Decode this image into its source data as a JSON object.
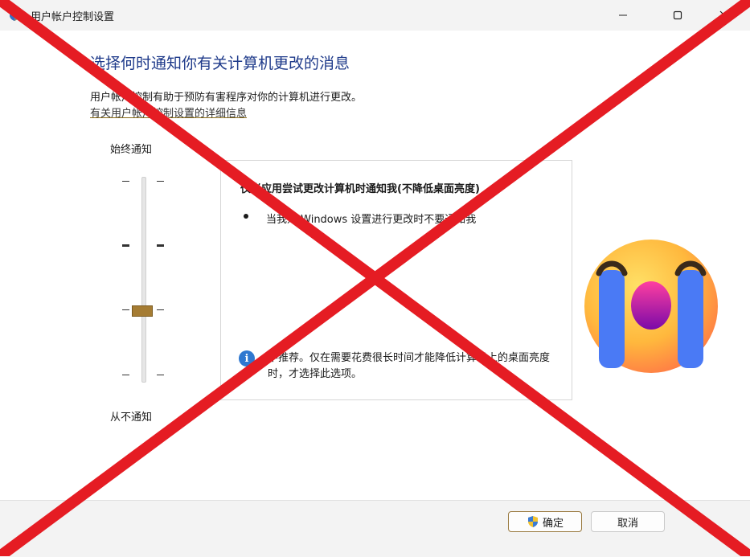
{
  "window": {
    "title": "用户帐户控制设置"
  },
  "main": {
    "heading": "选择何时通知你有关计算机更改的消息",
    "description": "用户帐户控制有助于预防有害程序对你的计算机进行更改。",
    "help_link": "有关用户帐户控制设置的详细信息"
  },
  "slider": {
    "top_label": "始终通知",
    "bottom_label": "从不通知",
    "level": "2 of 4"
  },
  "info_box": {
    "title": "仅当应用尝试更改计算机时通知我(不降低桌面亮度)",
    "bullet": "当我对 Windows 设置进行更改时不要通知我",
    "note": "不推荐。仅在需要花费很长时间才能降低计算机上的桌面亮度时，才选择此选项。"
  },
  "footer": {
    "ok_label": "确定",
    "cancel_label": "取消"
  },
  "icons": {
    "app": "shield-icon",
    "minimize": "minimize-icon",
    "maximize": "maximize-icon",
    "close": "close-icon",
    "info": "info-icon",
    "emoji": "crying-face-icon",
    "ok_shield": "uac-shield-icon"
  },
  "colors": {
    "heading": "#1e3a8a",
    "thumb": "#a57c33",
    "info": "#2f78d0",
    "cross": "#e51c23"
  }
}
